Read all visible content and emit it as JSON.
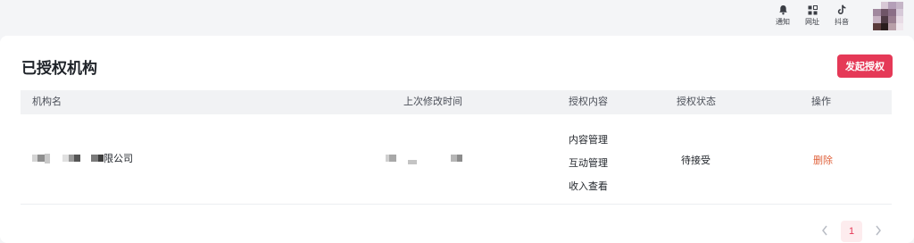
{
  "topbar": {
    "actions": [
      {
        "label": "通知",
        "icon": "bell-icon"
      },
      {
        "label": "网址",
        "icon": "grid-icon"
      },
      {
        "label": "抖音",
        "icon": "tiktok-icon"
      }
    ]
  },
  "page": {
    "title": "已授权机构",
    "primary_action": "发起授权"
  },
  "table": {
    "columns": [
      "机构名",
      "上次修改时间",
      "授权内容",
      "授权状态",
      "操作"
    ],
    "rows": [
      {
        "org_name_suffix": "限公司",
        "permissions": [
          "内容管理",
          "互动管理",
          "收入查看"
        ],
        "status": "待接受",
        "action": "删除"
      }
    ]
  },
  "pagination": {
    "current_page": "1"
  },
  "colors": {
    "accent": "#e53957",
    "delete": "#e0633d",
    "header_bg": "#f1f2f4"
  }
}
